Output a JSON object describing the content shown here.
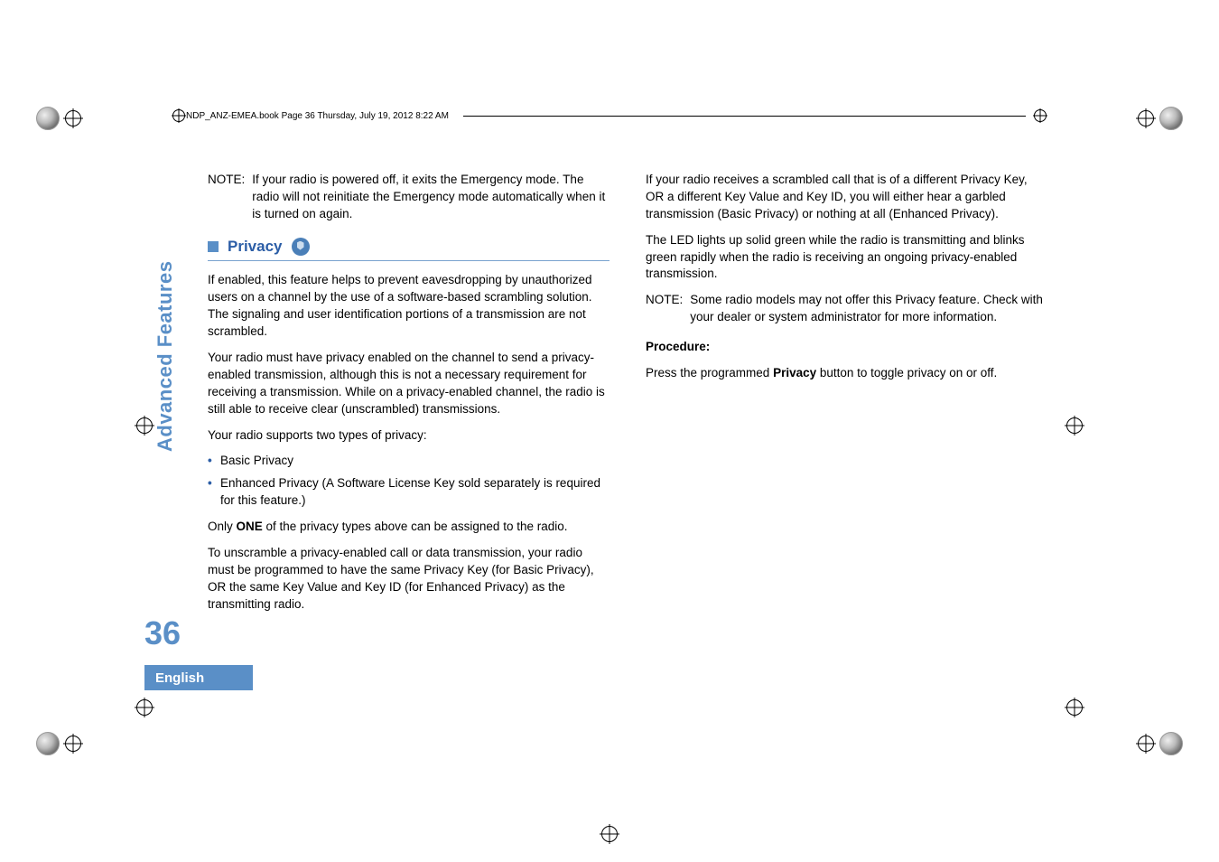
{
  "header": {
    "running_head": "NDP_ANZ-EMEA.book  Page 36  Thursday, July 19, 2012  8:22 AM"
  },
  "sidebar": {
    "section_label": "Advanced Features",
    "page_number": "36",
    "language": "English"
  },
  "left": {
    "note_label": "NOTE:",
    "note_body": "If your radio is powered off, it exits the Emergency mode. The radio will not reinitiate the Emergency mode automatically when it is turned on again.",
    "privacy_title": "Privacy",
    "p1": "If enabled, this feature helps to prevent eavesdropping by unauthorized users on a channel by the use of a software-based scrambling solution. The signaling and user identification portions of a transmission are not scrambled.",
    "p2": "Your radio must have privacy enabled on the channel to send a privacy-enabled transmission, although this is not a necessary requirement for receiving a transmission. While on a privacy-enabled channel, the radio is still able to receive clear (unscrambled) transmissions.",
    "p3": "Your radio supports two types of privacy:",
    "bullet1": "Basic Privacy",
    "bullet2": "Enhanced Privacy (A Software License Key sold separately is required for this feature.)",
    "p4_pre": "Only ",
    "p4_bold": "ONE",
    "p4_post": " of the privacy types above can be assigned to the radio.",
    "p5": "To unscramble a privacy-enabled call or data transmission, your radio must be programmed to have the same Privacy Key (for Basic Privacy), OR the same Key Value and Key ID (for Enhanced Privacy) as the transmitting radio."
  },
  "right": {
    "p1": "If your radio receives a scrambled call that is of a different Privacy Key, OR a different Key Value and Key ID, you will either hear a garbled transmission (Basic Privacy) or nothing at all (Enhanced Privacy).",
    "p2": "The LED lights up solid green while the radio is transmitting and blinks green rapidly when the radio is receiving an ongoing privacy-enabled transmission.",
    "note_label": "NOTE:",
    "note_body": "Some radio models may not offer this Privacy feature. Check with your dealer or system administrator for more information.",
    "procedure_label": "Procedure:",
    "proc_pre": "Press the programmed ",
    "proc_bold": "Privacy",
    "proc_post": " button to toggle privacy on or off."
  }
}
